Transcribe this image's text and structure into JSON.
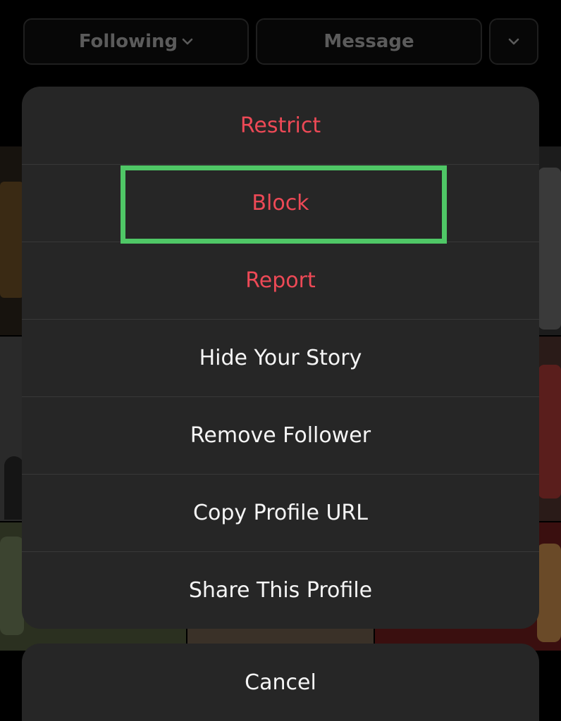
{
  "header": {
    "following_label": "Following",
    "message_label": "Message"
  },
  "sheet": {
    "items": [
      {
        "label": "Restrict",
        "style": "danger"
      },
      {
        "label": "Block",
        "style": "danger",
        "highlighted": true
      },
      {
        "label": "Report",
        "style": "danger"
      },
      {
        "label": "Hide Your Story",
        "style": "normal"
      },
      {
        "label": "Remove Follower",
        "style": "normal"
      },
      {
        "label": "Copy Profile URL",
        "style": "normal"
      },
      {
        "label": "Share This Profile",
        "style": "normal"
      }
    ],
    "highlight_color": "#4fc766"
  },
  "cancel_label": "Cancel",
  "colors": {
    "danger": "#ed4956",
    "text": "#f5f5f5",
    "sheet_bg": "#262626"
  },
  "icons": {
    "following_chevron": "chevron-down-icon",
    "more": "chevron-down-icon"
  }
}
